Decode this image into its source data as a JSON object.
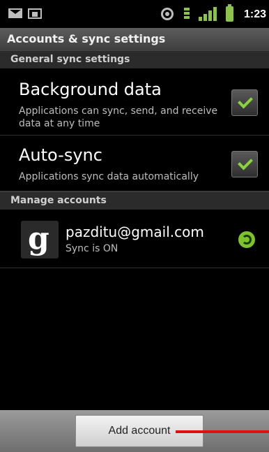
{
  "status_bar": {
    "time": "1:23",
    "icons": [
      "mail-icon",
      "screen-icon",
      "gps-icon",
      "usb-debug-icon",
      "signal-icon",
      "battery-icon"
    ]
  },
  "title": "Accounts & sync settings",
  "general": {
    "header": "General sync settings",
    "background_data": {
      "title": "Background data",
      "summary": "Applications can sync, send, and receive data at any time",
      "checked": true
    },
    "auto_sync": {
      "title": "Auto-sync",
      "summary": "Applications sync data automatically",
      "checked": true
    }
  },
  "manage": {
    "header": "Manage accounts",
    "accounts": [
      {
        "logo": "g",
        "email": "pazditu@gmail.com",
        "status": "Sync is ON",
        "icon": "sync-icon"
      }
    ]
  },
  "bottom": {
    "add_account_label": "Add account"
  },
  "colors": {
    "accent_green": "#8bd33a",
    "pointer_red": "#e01010"
  }
}
